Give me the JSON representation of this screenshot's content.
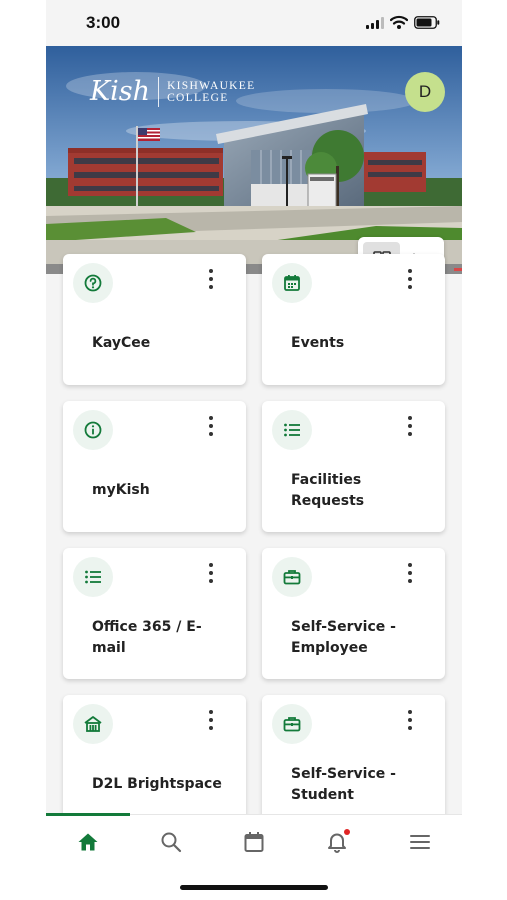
{
  "status_bar": {
    "time": "3:00"
  },
  "header": {
    "logo_script": "Kish",
    "logo_line1": "KISHWAUKEE",
    "logo_line2": "COLLEGE",
    "avatar_initial": "D",
    "view_modes": [
      "grid-view-icon",
      "list-view-icon"
    ],
    "active_view": "grid"
  },
  "tiles": [
    {
      "label": "KayCee",
      "icon": "help-circle-icon"
    },
    {
      "label": "Events",
      "icon": "calendar-icon"
    },
    {
      "label": "myKish",
      "icon": "info-circle-icon"
    },
    {
      "label": "Facilities Requests",
      "icon": "list-icon"
    },
    {
      "label": "Office 365 / E-mail",
      "icon": "list-icon"
    },
    {
      "label": "Self-Service - Employee",
      "icon": "briefcase-icon"
    },
    {
      "label": "D2L Brightspace",
      "icon": "campus-icon"
    },
    {
      "label": "Self-Service - Student",
      "icon": "briefcase-icon"
    }
  ],
  "bottom_nav": {
    "items": [
      "home-icon",
      "search-icon",
      "calendar-icon",
      "notification-bell-icon",
      "menu-icon"
    ],
    "active": "home-icon"
  },
  "colors": {
    "accent": "#137a3a",
    "icon_bg": "#ecf4ef",
    "avatar": "#c5e08d",
    "notification": "#e02424"
  }
}
